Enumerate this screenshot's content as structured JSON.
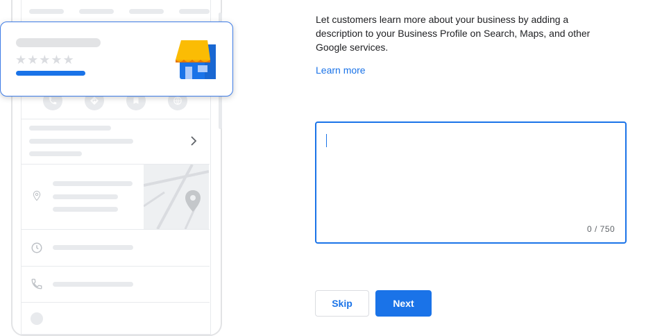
{
  "description_text": "Let customers learn more about your business by adding a description to your Business Profile on Search, Maps, and other Google services.",
  "learn_more_label": "Learn more",
  "description_input": {
    "value": "",
    "counter": "0 / 750"
  },
  "buttons": {
    "skip": "Skip",
    "next": "Next"
  },
  "preview": {
    "rating_stars": "★★★★★"
  },
  "icons": [
    "phone-icon",
    "directions-icon",
    "bookmark-icon",
    "website-icon",
    "chevron-right-icon",
    "location-pin-icon",
    "clock-icon",
    "phone-icon",
    "storefront-icon"
  ],
  "colors": {
    "accent": "#1a73e8",
    "awning": "#fbbc04",
    "placeholder": "#e8eaed"
  }
}
